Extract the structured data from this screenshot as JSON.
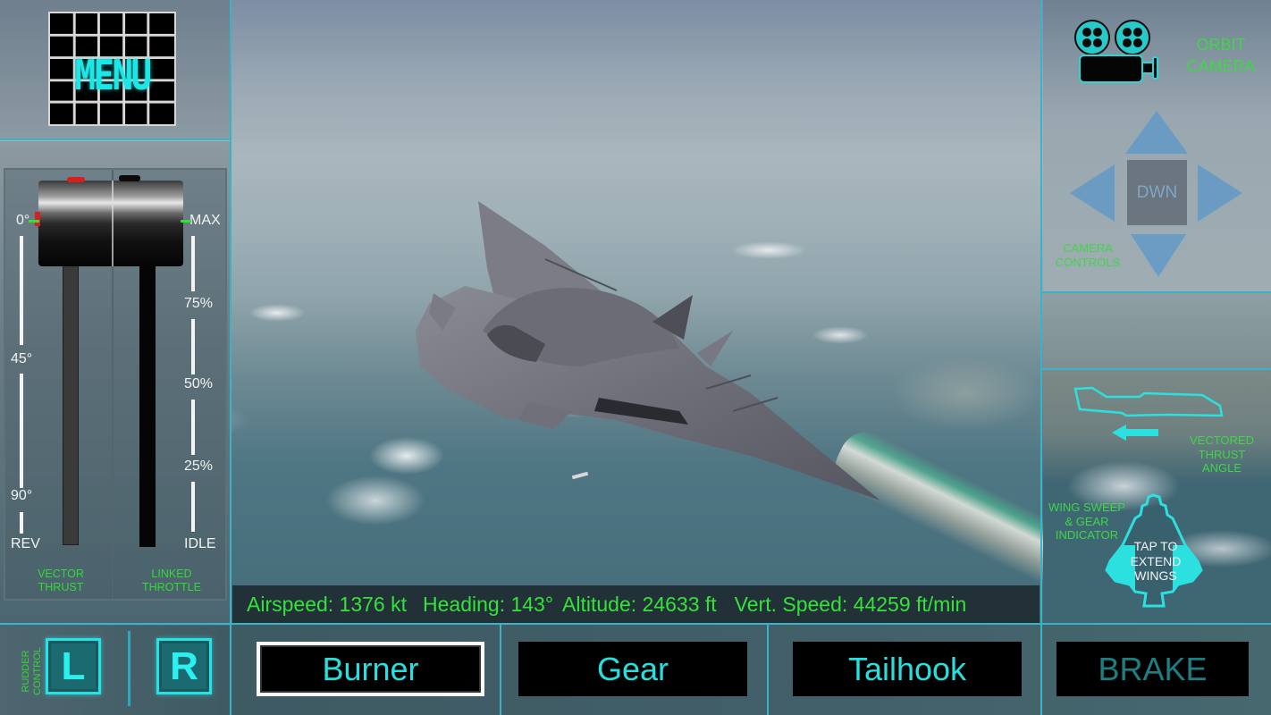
{
  "menu": {
    "label": "MENU"
  },
  "throttle_panel": {
    "vector_scale": {
      "top": "0°",
      "mid": "45°",
      "bottom_mid": "90°",
      "bottom": "REV"
    },
    "throttle_scale": {
      "top": "MAX",
      "p75": "75%",
      "p50": "50%",
      "p25": "25%",
      "bottom": "IDLE"
    },
    "vector_caption": "VECTOR\nTHRUST",
    "throttle_caption": "LINKED\nTHROTTLE"
  },
  "rudder": {
    "caption": "RUDDER CONTROL",
    "left_label": "L",
    "right_label": "R"
  },
  "telemetry": {
    "airspeed": "Airspeed: 1376 kt",
    "heading": "Heading: 143°",
    "altitude": "Altitude: 24633 ft",
    "vert_speed": "Vert. Speed: 44259 ft/min"
  },
  "bottom_bar": {
    "burner": "Burner",
    "gear": "Gear",
    "tailhook": "Tailhook",
    "brake": "BRAKE"
  },
  "camera": {
    "orbit_label": "ORBIT\nCAMERA",
    "dwn_label": "DWN",
    "controls_caption": "CAMERA\nCONTROLS"
  },
  "indicators": {
    "vectored_caption": "VECTORED\nTHRUST\nANGLE",
    "wing_caption": "WING SWEEP\n& GEAR\nINDICATOR",
    "wing_label": "TAP TO\nEXTEND\nWINGS"
  },
  "colors": {
    "frame": "#3ab3c9",
    "hud_green": "#35e23a",
    "hud_cyan": "#26e0e0",
    "brake_dim": "#1b7f84"
  }
}
